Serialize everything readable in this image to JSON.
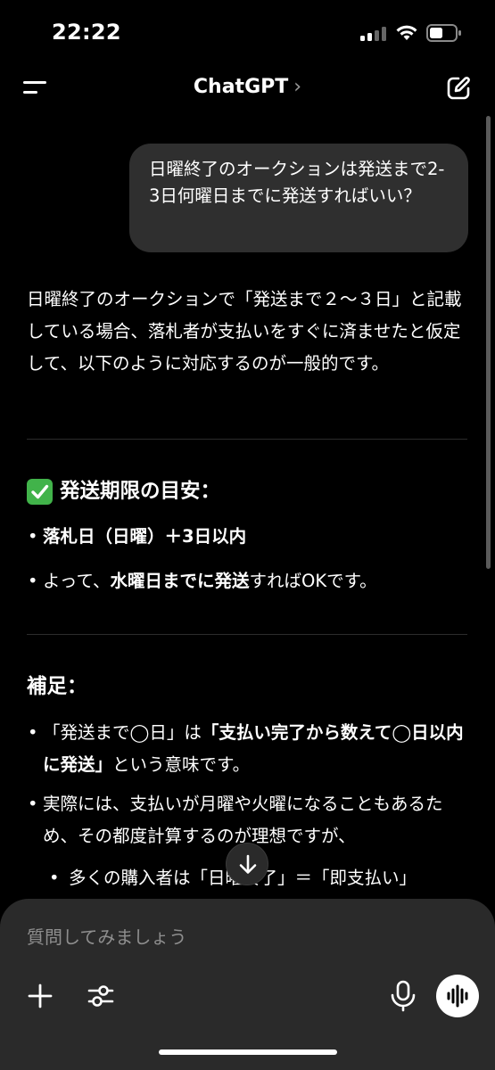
{
  "status_bar": {
    "time": "22:22"
  },
  "nav": {
    "title": "ChatGPT",
    "chevron": "›"
  },
  "user_message": "日曜終了のオークションは発送まで2-3日何曜日までに発送すればいい？",
  "assistant": {
    "intro": "日曜終了のオークションで「発送まで２〜３日」と記載している場合、落札者が支払いをすぐに済ませたと仮定して、以下のように対応するのが一般的です。",
    "section1": {
      "heading": "発送期限の目安：",
      "bullet1": "落札日（日曜）＋3日以内",
      "bullet2_pre": "よって、",
      "bullet2_bold": "水曜日までに発送",
      "bullet2_post": "すればOKです。"
    },
    "section2": {
      "heading": "補足：",
      "bullet1_pre": "「発送まで◯日」は",
      "bullet1_bold": "「支払い完了から数えて◯日以内に発送」",
      "bullet1_post": "という意味です。",
      "bullet2": "実際には、支払いが月曜や火曜になることもあるため、その都度計算するのが理想ですが、",
      "sub_bullet": "多くの購入者は「日曜終了」＝「即支払い」"
    }
  },
  "input": {
    "placeholder": "質問してみましょう"
  },
  "colors": {
    "background": "#000000",
    "bubble": "#2f2f2f",
    "panel": "#2a2a2a",
    "check": "#41b34a"
  },
  "icons": [
    "menu-icon",
    "compose-icon",
    "check-icon",
    "arrow-down-icon",
    "plus-icon",
    "tools-icon",
    "mic-icon",
    "voice-icon"
  ]
}
